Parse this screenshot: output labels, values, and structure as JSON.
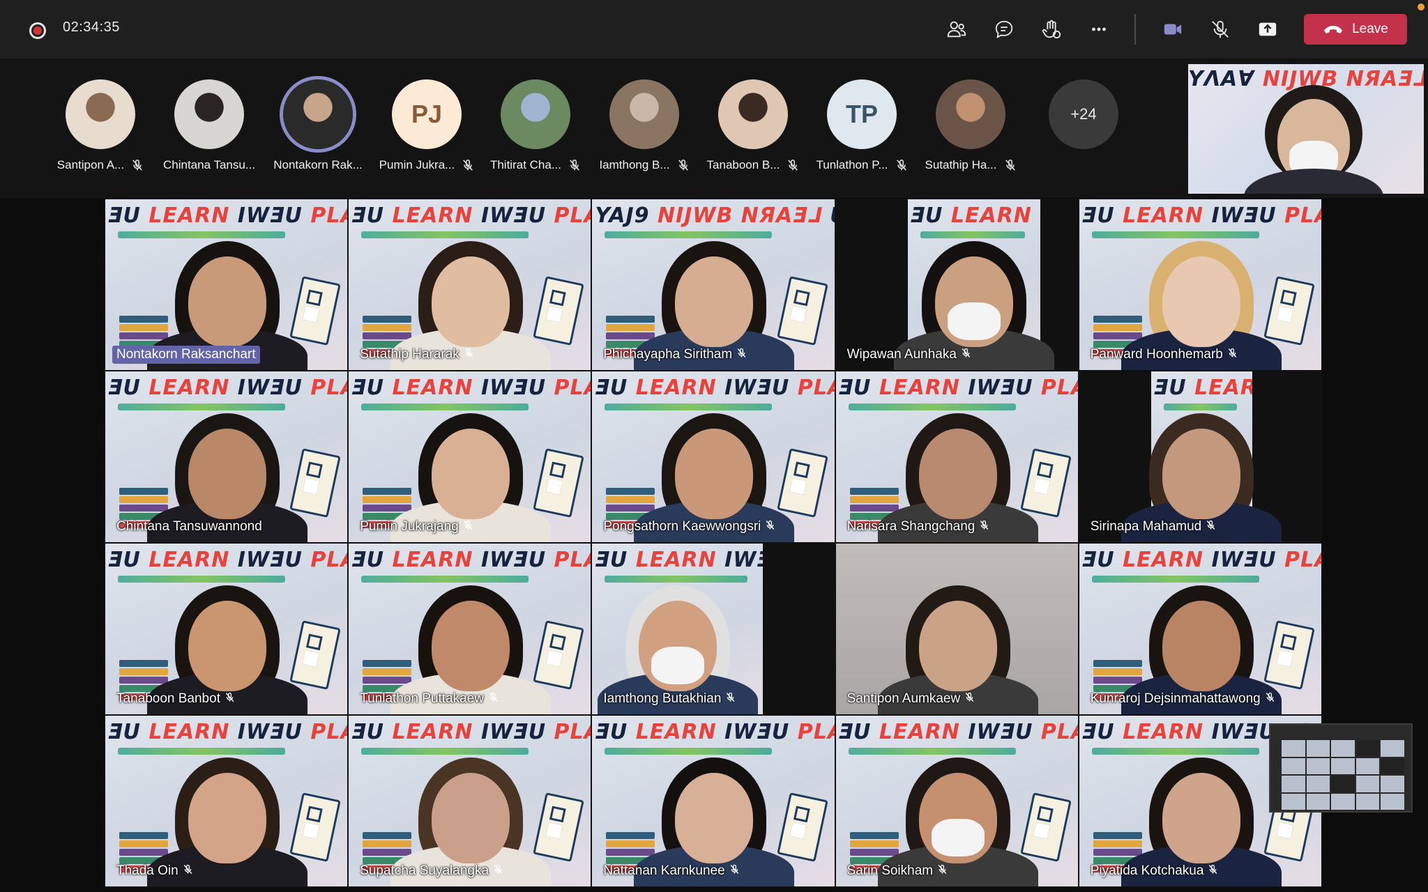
{
  "meeting": {
    "elapsed": "02:34:35",
    "leave_label": "Leave",
    "overflow_count": "+24"
  },
  "toolbar": {
    "icons": [
      "people-icon",
      "chat-icon",
      "raise-hand-icon",
      "more-icon",
      "camera-icon",
      "mic-off-icon",
      "share-icon"
    ]
  },
  "colors": {
    "leave": "#c4314b",
    "active_ring": "#8b8cc7",
    "name_highlight": "#6264a7",
    "recording": "#d13438"
  },
  "participants_strip": [
    {
      "name": "Santipon A...",
      "avatar": "photo",
      "muted": true
    },
    {
      "name": "Chintana Tansu...",
      "avatar": "photo",
      "muted": false
    },
    {
      "name": "Nontakorn Rak...",
      "avatar": "photo",
      "muted": false,
      "speaking": true
    },
    {
      "name": "Pumin Jukra...",
      "avatar": "initials",
      "initials": "PJ",
      "muted": true
    },
    {
      "name": "Thitirat Cha...",
      "avatar": "photo",
      "muted": true
    },
    {
      "name": "Iamthong B...",
      "avatar": "photo",
      "muted": true
    },
    {
      "name": "Tanaboon B...",
      "avatar": "photo",
      "muted": true
    },
    {
      "name": "Tunlathon P...",
      "avatar": "initials",
      "initials": "TP",
      "muted": true
    },
    {
      "name": "Sutathip Ha...",
      "avatar": "photo",
      "muted": true
    }
  ],
  "grid": [
    {
      "name": "Nontakorn Raksanchart",
      "muted": false,
      "highlight": true
    },
    {
      "name": "Sutathip Hararak",
      "muted": true
    },
    {
      "name": "Phichayapha Siritham",
      "muted": true
    },
    {
      "name": "Wipawan Aunhaka",
      "muted": true
    },
    {
      "name": "Panward Hoonhemarb",
      "muted": true
    },
    {
      "name": "Chintana Tansuwannond",
      "muted": false
    },
    {
      "name": "Pumin Jukrajang",
      "muted": true
    },
    {
      "name": "Pongsathorn Kaewwongsri",
      "muted": true
    },
    {
      "name": "Narisara Shangchang",
      "muted": true
    },
    {
      "name": "Sirinapa Mahamud",
      "muted": true
    },
    {
      "name": "Tanaboon Banbot",
      "muted": true
    },
    {
      "name": "Tunlathon Puttakaew",
      "muted": true
    },
    {
      "name": "Iamthong Butakhian",
      "muted": true
    },
    {
      "name": "Santipon Aumkaew",
      "muted": true
    },
    {
      "name": "Kunraroj Dejsinmahattawong",
      "muted": true
    },
    {
      "name": "Thada Oin",
      "muted": true
    },
    {
      "name": "Supatcha Suyalangka",
      "muted": true
    },
    {
      "name": "Nattanan Karnkunee",
      "muted": true
    },
    {
      "name": "Sarin Soikham",
      "muted": true
    },
    {
      "name": "Piyatida Kotchakua",
      "muted": true
    }
  ]
}
